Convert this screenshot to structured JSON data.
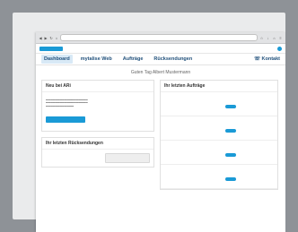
{
  "browser": {
    "url": "",
    "nav_icons": [
      "back-icon",
      "forward-icon",
      "refresh-icon",
      "home-icon"
    ],
    "tool_icons": [
      "star-icon",
      "download-icon",
      "home-icon",
      "menu-icon"
    ]
  },
  "nav": {
    "items": [
      {
        "label": "Dashboard",
        "active": true
      },
      {
        "label": "mytalise Web",
        "active": false
      },
      {
        "label": "Aufträge",
        "active": false
      },
      {
        "label": "Rücksendungen",
        "active": false
      }
    ],
    "contact": "Kontakt"
  },
  "greeting": "Guten Tag Albert Mustermann",
  "news": {
    "title": "Neu bei ARi",
    "headline": "",
    "button": ""
  },
  "returns": {
    "title": "Ihr letzten Rücksendungen",
    "link": "",
    "text": "",
    "button": ""
  },
  "orders": {
    "title": "Ihr letzten Aufträge",
    "link": "",
    "items": [
      {
        "id": "",
        "status": ""
      },
      {
        "id": "",
        "status": ""
      },
      {
        "id": "",
        "status": ""
      },
      {
        "id": "",
        "status": ""
      }
    ]
  },
  "colors": {
    "accent": "#1a9ad6",
    "nav_text": "#1f4f7a",
    "active_tab": "#d8e9f6"
  }
}
